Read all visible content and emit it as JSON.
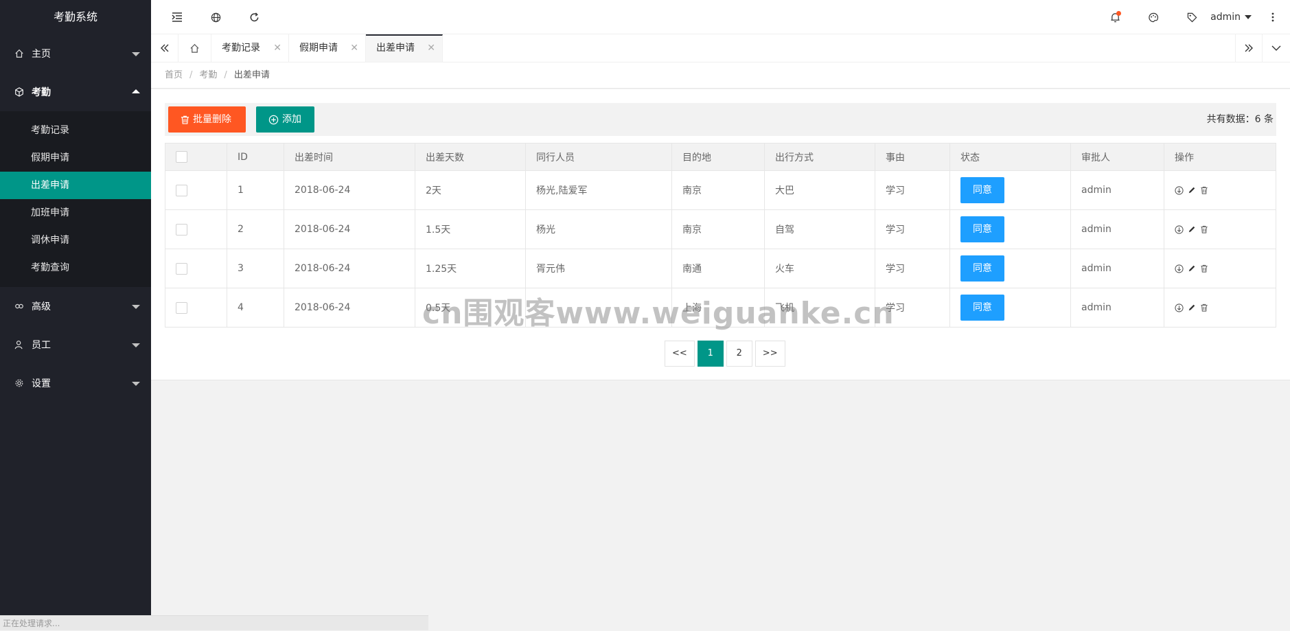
{
  "app": {
    "title": "考勤系统"
  },
  "sidebar": {
    "groups": [
      {
        "label": "主页",
        "icon": "home-icon"
      },
      {
        "label": "考勤",
        "icon": "cube-icon"
      },
      {
        "label": "高级",
        "icon": "link-icon"
      },
      {
        "label": "员工",
        "icon": "user-icon"
      },
      {
        "label": "设置",
        "icon": "gear-icon"
      }
    ],
    "submenu": [
      "考勤记录",
      "假期申请",
      "出差申请",
      "加班申请",
      "调休申请",
      "考勤查询"
    ],
    "active_sub": "出差申请"
  },
  "header": {
    "user": "admin"
  },
  "tabs": [
    {
      "label": "考勤记录"
    },
    {
      "label": "假期申请"
    },
    {
      "label": "出差申请"
    }
  ],
  "breadcrumb": [
    "首页",
    "考勤",
    "出差申请"
  ],
  "toolbar": {
    "batch_delete": "批量删除",
    "add": "添加",
    "total": "共有数据：6 条"
  },
  "table": {
    "headers": [
      "ID",
      "出差时间",
      "出差天数",
      "同行人员",
      "目的地",
      "出行方式",
      "事由",
      "状态",
      "审批人",
      "操作"
    ],
    "rows": [
      {
        "id": "1",
        "date": "2018-06-24",
        "days": "2天",
        "companions": "杨光,陆爱军",
        "dest": "南京",
        "mode": "大巴",
        "reason": "学习",
        "status": "同意",
        "approver": "admin"
      },
      {
        "id": "2",
        "date": "2018-06-24",
        "days": "1.5天",
        "companions": "杨光",
        "dest": "南京",
        "mode": "自驾",
        "reason": "学习",
        "status": "同意",
        "approver": "admin"
      },
      {
        "id": "3",
        "date": "2018-06-24",
        "days": "1.25天",
        "companions": "胥元伟",
        "dest": "南通",
        "mode": "火车",
        "reason": "学习",
        "status": "同意",
        "approver": "admin"
      },
      {
        "id": "4",
        "date": "2018-06-24",
        "days": "0.5天",
        "companions": "",
        "dest": "上海",
        "mode": "飞机",
        "reason": "学习",
        "status": "同意",
        "approver": "admin"
      }
    ]
  },
  "pagination": {
    "prev": "<<",
    "pages": [
      "1",
      "2"
    ],
    "next": ">>",
    "current": "1"
  },
  "status_bar": "正在处理请求...",
  "watermark": "cn围观客www.weiguanke.cn",
  "colors": {
    "sidebar": "#20222a",
    "accent": "#009688",
    "danger": "#ff5722",
    "primary": "#1e9fff"
  }
}
